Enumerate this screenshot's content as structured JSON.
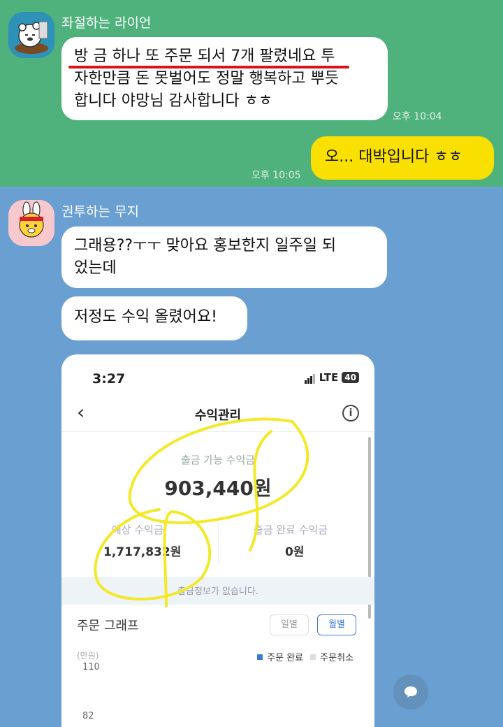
{
  "chat": {
    "sender1": {
      "name": "좌절하는 라이언"
    },
    "msg1": {
      "lines": [
        "방 금 하나 또 주문 되서 7개 팔렸네요 투",
        "자한만큼 돈 못벌어도 정말 행복하고 뿌듯",
        "합니다 야망님 감사합니다 ㅎㅎ"
      ],
      "time": "오후 10:04"
    },
    "reply": {
      "text": "오... 대박입니다 ㅎㅎ",
      "time": "오후 10:05"
    },
    "sender2": {
      "name": "권투하는 무지"
    },
    "msg2": {
      "lines": [
        "그래용??ㅜㅜ 맞아요 홍보한지  일주일 되",
        "었는데"
      ]
    },
    "msg3": {
      "text": "저정도 수익 올렸어요!"
    }
  },
  "screenshot": {
    "clock": "3:27",
    "network": "LTE",
    "battery": "40",
    "back_icon": "chevron-left-icon",
    "title": "수익관리",
    "info_icon": "info-icon",
    "available_label": "출금 가능 수익금",
    "available_value": "903,440원",
    "expected_label": "예상 수익금",
    "expected_value": "1,717,832원",
    "withdrawn_label": "출금 완료 수익금",
    "withdrawn_value": "0원",
    "band_text": "출금정보가 없습니다.",
    "graph_title": "주문 그래프",
    "toggle_daily": "일별",
    "toggle_monthly": "월별",
    "legend_done": "주문 완료",
    "legend_cancel": "주문취소",
    "unit": "(만원)",
    "yticks": [
      "110",
      "82"
    ]
  },
  "colors": {
    "top_bg": "#4fb27c",
    "bottom_bg": "#6a9fd1",
    "my_bubble": "#f9e000",
    "underline": "#e0101a",
    "highlight": "#f3e92a",
    "accent": "#3a79d6"
  },
  "fab_icon": "chat-bubble-icon"
}
